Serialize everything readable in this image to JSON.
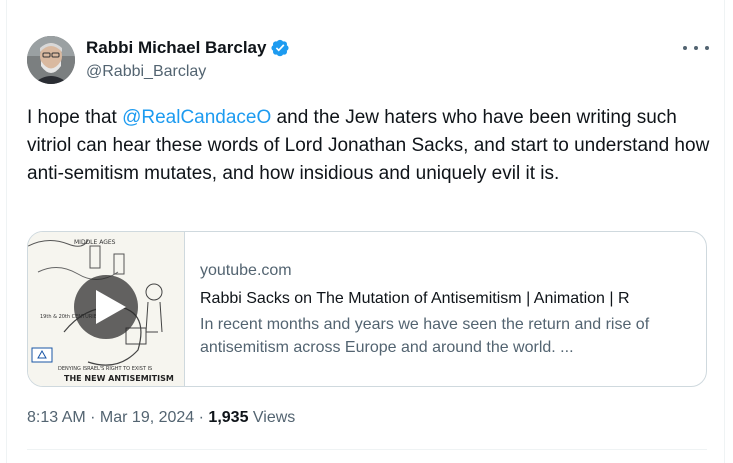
{
  "author": {
    "display_name": "Rabbi Michael Barclay",
    "handle": "@Rabbi_Barclay"
  },
  "tweet": {
    "text_before": "I hope that ",
    "mention": "@RealCandaceO",
    "text_after": " and the Jew haters who have been writing such vitriol can hear these words of Lord Jonathan Sacks, and start to understand how anti-semitism mutates, and how insidious and uniquely evil it is."
  },
  "card": {
    "domain": "youtube.com",
    "title": "Rabbi Sacks on The Mutation of Antisemitism | Animation | R",
    "description": "In recent months and years we have seen the return and rise of antisemitism across Europe and around the world. ...",
    "thumbnail_labels": {
      "middle_ages": "MIDDLE AGES",
      "centuries": "19th & 20th CENTURIES",
      "caption1": "DENYING ISRAEL'S RIGHT TO EXIST IS",
      "caption2": "THE NEW ANTISEMITISM"
    }
  },
  "meta": {
    "time": "8:13 AM",
    "separator": " · ",
    "date": "Mar 19, 2024",
    "views_count": "1,935",
    "views_label": " Views"
  },
  "colors": {
    "link": "#1d9bf0",
    "verified": "#1d9bf0",
    "secondary_text": "#536471",
    "primary_text": "#0f1419"
  }
}
